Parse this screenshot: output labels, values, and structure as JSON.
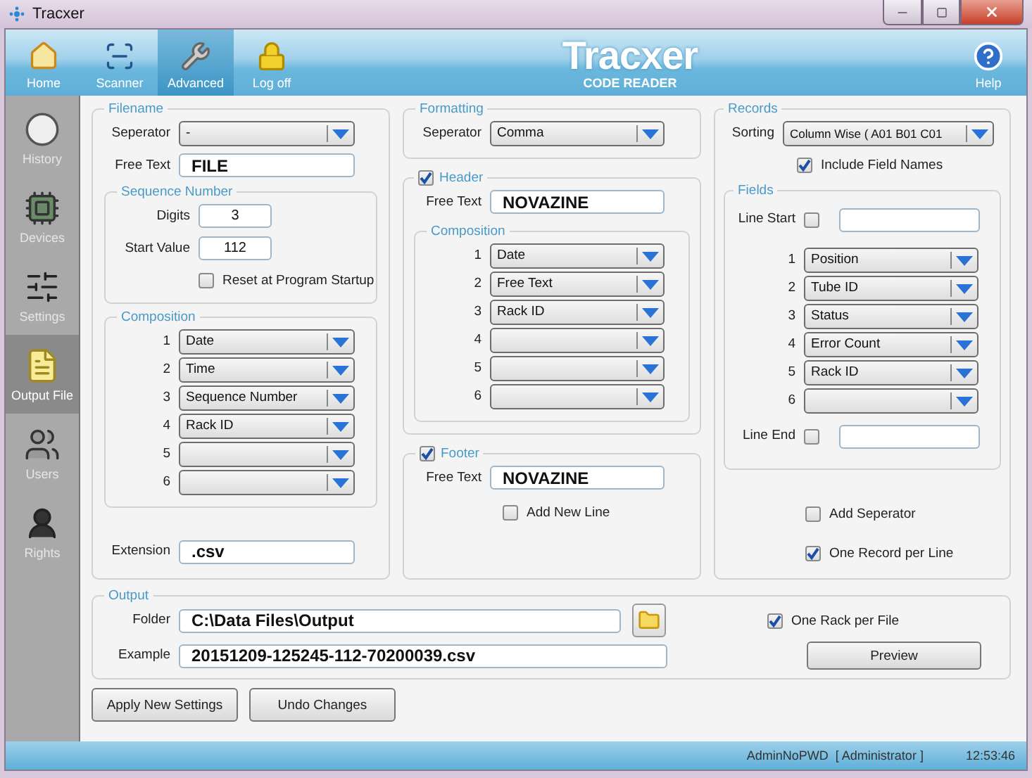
{
  "window": {
    "title": "Tracxer"
  },
  "toolbar": {
    "items": [
      {
        "label": "Home",
        "selected": false
      },
      {
        "label": "Scanner",
        "selected": false
      },
      {
        "label": "Advanced",
        "selected": true
      },
      {
        "label": "Log off",
        "selected": false
      }
    ],
    "logo": {
      "name": "Tracxer",
      "subtitle": "CODE READER"
    },
    "help": "Help"
  },
  "sidebar": {
    "items": [
      {
        "label": "History",
        "selected": false
      },
      {
        "label": "Devices",
        "selected": false
      },
      {
        "label": "Settings",
        "selected": false
      },
      {
        "label": "Output File",
        "selected": true
      },
      {
        "label": "Users",
        "selected": false
      },
      {
        "label": "Rights",
        "selected": false
      }
    ]
  },
  "filename": {
    "title": "Filename",
    "separator": {
      "label": "Seperator",
      "value": "-"
    },
    "free_text": {
      "label": "Free Text",
      "value": "FILE"
    },
    "sequence": {
      "title": "Sequence Number",
      "digits": {
        "label": "Digits",
        "value": "3"
      },
      "start_value": {
        "label": "Start Value",
        "value": "112"
      },
      "reset": {
        "label": "Reset at Program Startup",
        "checked": false
      }
    },
    "composition": {
      "title": "Composition",
      "slots": [
        {
          "number": "1",
          "value": "Date"
        },
        {
          "number": "2",
          "value": "Time"
        },
        {
          "number": "3",
          "value": "Sequence Number"
        },
        {
          "number": "4",
          "value": "Rack ID"
        },
        {
          "number": "5"
        },
        {
          "number": "6"
        }
      ]
    },
    "extension": {
      "label": "Extension",
      "value": ".csv"
    }
  },
  "formatting": {
    "title": "Formatting",
    "separator": {
      "label": "Seperator",
      "value": "Comma"
    }
  },
  "header": {
    "title": "Header",
    "checked": true,
    "free_text": {
      "label": "Free Text",
      "value": "NOVAZINE"
    },
    "composition": {
      "title": "Composition",
      "slots": [
        {
          "number": "1",
          "value": "Date"
        },
        {
          "number": "2",
          "value": "Free Text"
        },
        {
          "number": "3",
          "value": "Rack ID"
        },
        {
          "number": "4"
        },
        {
          "number": "5"
        },
        {
          "number": "6"
        }
      ]
    }
  },
  "footer": {
    "title": "Footer",
    "checked": true,
    "free_text": {
      "label": "Free Text",
      "value": "NOVAZINE"
    },
    "add_new_line": {
      "label": "Add New Line",
      "checked": false
    }
  },
  "records": {
    "title": "Records",
    "sorting": {
      "label": "Sorting",
      "value": "Column Wise ( A01 B01 C01"
    },
    "include_field_names": {
      "label": "Include Field Names",
      "checked": true
    },
    "fields": {
      "title": "Fields",
      "line_start": {
        "label": "Line Start",
        "checked": false
      },
      "slots": [
        {
          "number": "1",
          "value": "Position"
        },
        {
          "number": "2",
          "value": "Tube ID"
        },
        {
          "number": "3",
          "value": "Status"
        },
        {
          "number": "4",
          "value": "Error Count"
        },
        {
          "number": "5",
          "value": "Rack ID"
        },
        {
          "number": "6"
        }
      ],
      "line_end": {
        "label": "Line End",
        "checked": false
      }
    },
    "add_separator": {
      "label": "Add Seperator",
      "checked": false
    },
    "one_record_per_line": {
      "label": "One Record per Line",
      "checked": true
    }
  },
  "output": {
    "title": "Output",
    "folder": {
      "label": "Folder",
      "value": "C:\\Data Files\\Output"
    },
    "example": {
      "label": "Example",
      "value": "20151209-125245-112-70200039.csv"
    },
    "one_rack_per_file": {
      "label": "One Rack per File",
      "checked": true
    },
    "preview": "Preview"
  },
  "buttons": [
    "Apply New Settings",
    "Undo Changes"
  ],
  "status_bar": {
    "user": "AdminNoPWD",
    "role": "[ Administrator ]",
    "time": "12:53:46"
  }
}
